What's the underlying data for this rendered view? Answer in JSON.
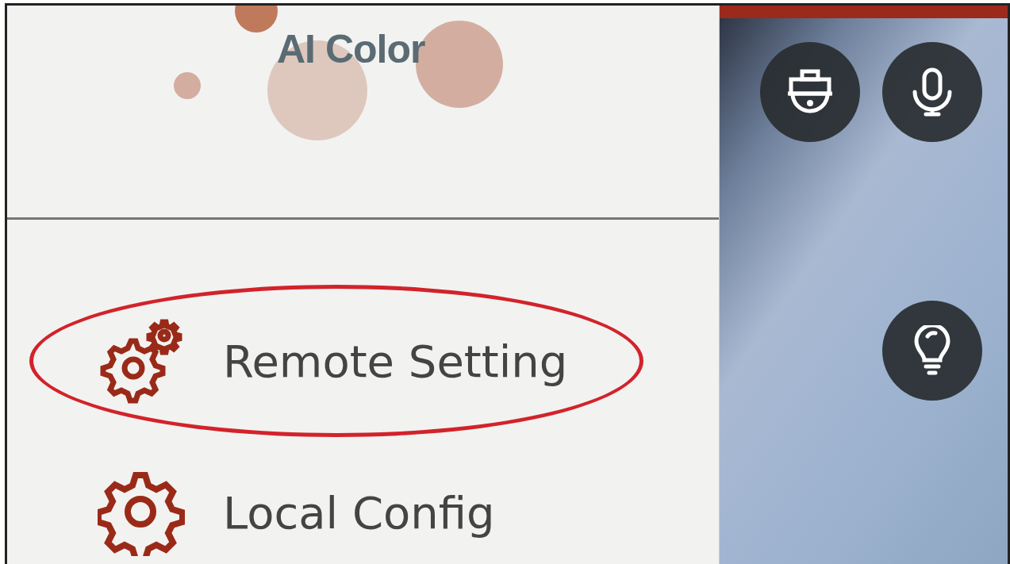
{
  "brand": {
    "title": "AI Color"
  },
  "menu": [
    {
      "label": "Remote Setting",
      "kind": "remote",
      "highlighted": true
    },
    {
      "label": "Local Config",
      "kind": "local",
      "highlighted": false
    }
  ],
  "video": {
    "controls": [
      {
        "kind": "ptz"
      },
      {
        "kind": "mic"
      },
      {
        "kind": "light"
      }
    ]
  }
}
